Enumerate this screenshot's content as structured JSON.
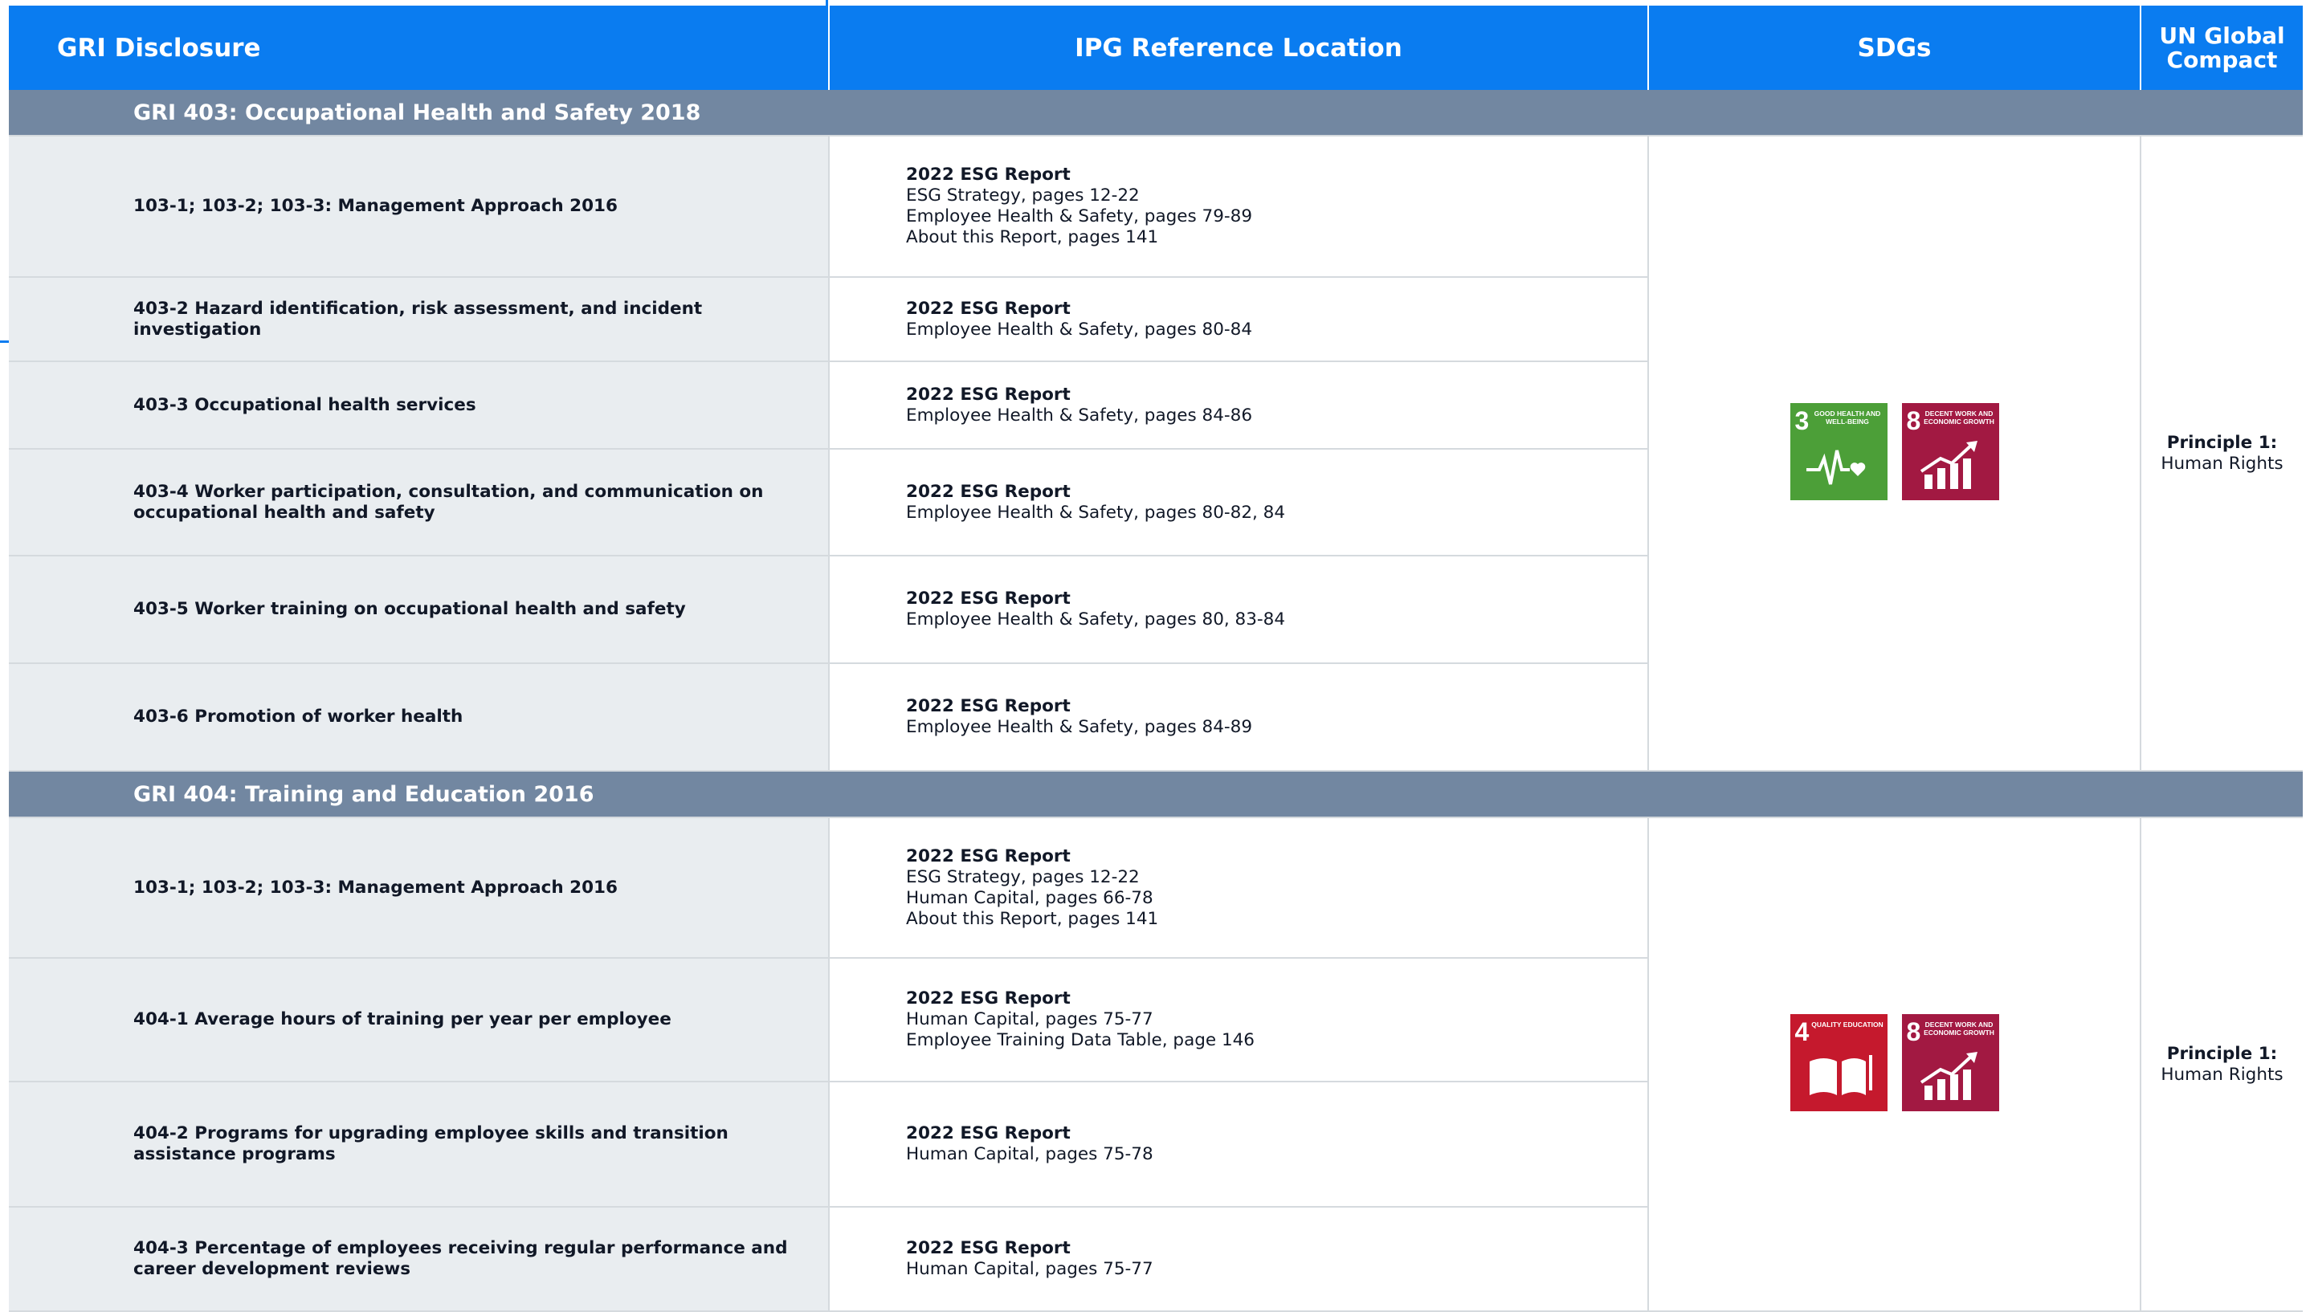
{
  "header": {
    "col1": "GRI Disclosure",
    "col2": "IPG Reference Location",
    "col3": "SDGs",
    "col4_line1": "UN Global",
    "col4_line2": "Compact"
  },
  "colors": {
    "header_bg": "#0a7cf0",
    "section_bg": "#7287a1",
    "disclosure_bg": "#e9edf0",
    "sdg3": "#4c9f38",
    "sdg4": "#c5192d",
    "sdg8": "#a21942"
  },
  "sections": [
    {
      "title": "GRI 403: Occupational Health and Safety 2018",
      "rows": [
        {
          "disclosure": "103-1; 103-2; 103-3: Management Approach 2016",
          "ref_title": "2022 ESG Report",
          "ref_lines": [
            "ESG Strategy, pages 12-22",
            "Employee Health & Safety, pages 79-89",
            "About this Report, pages 141"
          ]
        },
        {
          "disclosure": "403-2 Hazard identification, risk assessment, and incident investigation",
          "ref_title": "2022 ESG Report",
          "ref_lines": [
            "Employee Health & Safety, pages 80-84"
          ]
        },
        {
          "disclosure": "403-3 Occupational health services",
          "ref_title": "2022 ESG Report",
          "ref_lines": [
            "Employee Health & Safety, pages 84-86"
          ]
        },
        {
          "disclosure": "403-4 Worker participation, consultation, and communication on occupational health and safety",
          "ref_title": "2022 ESG Report",
          "ref_lines": [
            "Employee Health & Safety, pages 80-82, 84"
          ]
        },
        {
          "disclosure": "403-5 Worker training on occupational health and safety",
          "ref_title": "2022 ESG Report",
          "ref_lines": [
            "Employee Health & Safety, pages 80, 83-84"
          ]
        },
        {
          "disclosure": "403-6 Promotion of worker health",
          "ref_title": "2022 ESG Report",
          "ref_lines": [
            "Employee Health & Safety, pages 84-89"
          ]
        }
      ],
      "sdgs": [
        {
          "num": "3",
          "label": "Good Health and Well-Being",
          "icon": "heartbeat-icon"
        },
        {
          "num": "8",
          "label": "Decent Work and Economic Growth",
          "icon": "growth-chart-icon"
        }
      ],
      "ungc_principle": "Principle 1:",
      "ungc_text": "Human Rights"
    },
    {
      "title": "GRI 404: Training and Education 2016",
      "rows": [
        {
          "disclosure": "103-1; 103-2; 103-3: Management Approach 2016",
          "ref_title": "2022 ESG Report",
          "ref_lines": [
            "ESG Strategy, pages 12-22",
            "Human Capital, pages 66-78",
            "About this Report, pages 141"
          ]
        },
        {
          "disclosure": "404-1 Average hours of training per year per employee",
          "ref_title": "2022 ESG Report",
          "ref_lines": [
            "Human Capital, pages 75-77",
            "Employee Training Data Table, page 146"
          ]
        },
        {
          "disclosure": "404-2 Programs for upgrading employee skills and transition assistance programs",
          "ref_title": "2022 ESG Report",
          "ref_lines": [
            "Human Capital, pages 75-78"
          ]
        },
        {
          "disclosure": "404-3 Percentage of employees receiving regular performance and career development reviews",
          "ref_title": "2022 ESG Report",
          "ref_lines": [
            "Human Capital, pages 75-77"
          ]
        }
      ],
      "sdgs": [
        {
          "num": "4",
          "label": "Quality Education",
          "icon": "book-icon"
        },
        {
          "num": "8",
          "label": "Decent Work and Economic Growth",
          "icon": "growth-chart-icon"
        }
      ],
      "ungc_principle": "Principle 1:",
      "ungc_text": "Human Rights"
    }
  ]
}
